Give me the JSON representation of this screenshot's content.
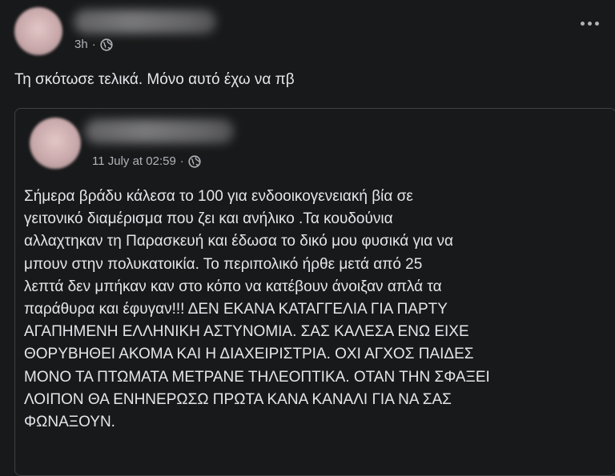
{
  "post": {
    "time": "3h",
    "privacy_icon": "globe-icon",
    "text": "Τη σκότωσε τελικά. Μόνο αυτό έχω να πβ"
  },
  "shared_post": {
    "time": "11 July at 02:59",
    "privacy_icon": "globe-icon",
    "text": "Σήμερα βράδυ κάλεσα το 100 για ενδοοικογενειακή βία σε\nγειτονικό διαμέρισμα που  ζει και ανήλικο .Τα κουδούνια\nαλλαχτηκαν τη Παρασκευή και έδωσα το δικό μου φυσικά για να\nμπουν στην πολυκατοικία. Το περιπολικό ήρθε μετά από 25\nλεπτά δεν μπήκαν καν στο κόπο να κατέβουν άνοιξαν απλά τα\nπαράθυρα και έφυγαν!!! ΔΕΝ ΕΚΑΝΑ ΚΑΤΑΓΓΕΛΙΑ ΓΙΑ ΠΑΡΤΥ\nΑΓΑΠΗΜΕΝΗ ΕΛΛΗΝΙΚΗ ΑΣΤΥΝΟΜΙΑ. ΣΑΣ ΚΑΛΕΣΑ ΕΝΩ ΕΙΧΕ\nΘΟΡΥΒΗΘΕΙ ΑΚΟΜΑ ΚΑΙ Η ΔΙΑΧΕΙΡΙΣΤΡΙΑ. ΟΧΙ ΑΓΧΟΣ ΠΑΙΔΕΣ\nΜΟΝΟ ΤΑ ΠΤΩΜΑΤΑ ΜΕΤΡΑΝΕ ΤΗΛΕΟΠΤΙΚΑ. ΟΤΑΝ ΤΗΝ ΣΦΑΞΕΙ\nΛΟΙΠΟΝ ΘΑ ΕΝΗΝΕΡΩΣΩ ΠΡΩΤΑ ΚΑΝΑ ΚΑΝΑΛΙ ΓΙΑ ΝΑ ΣΑΣ\nΦΩΝΑΞΟΥΝ."
  },
  "colors": {
    "background": "#18191a",
    "primary_text": "#e4e6eb",
    "secondary_text": "#b0b3b8",
    "border": "#3e4042"
  }
}
